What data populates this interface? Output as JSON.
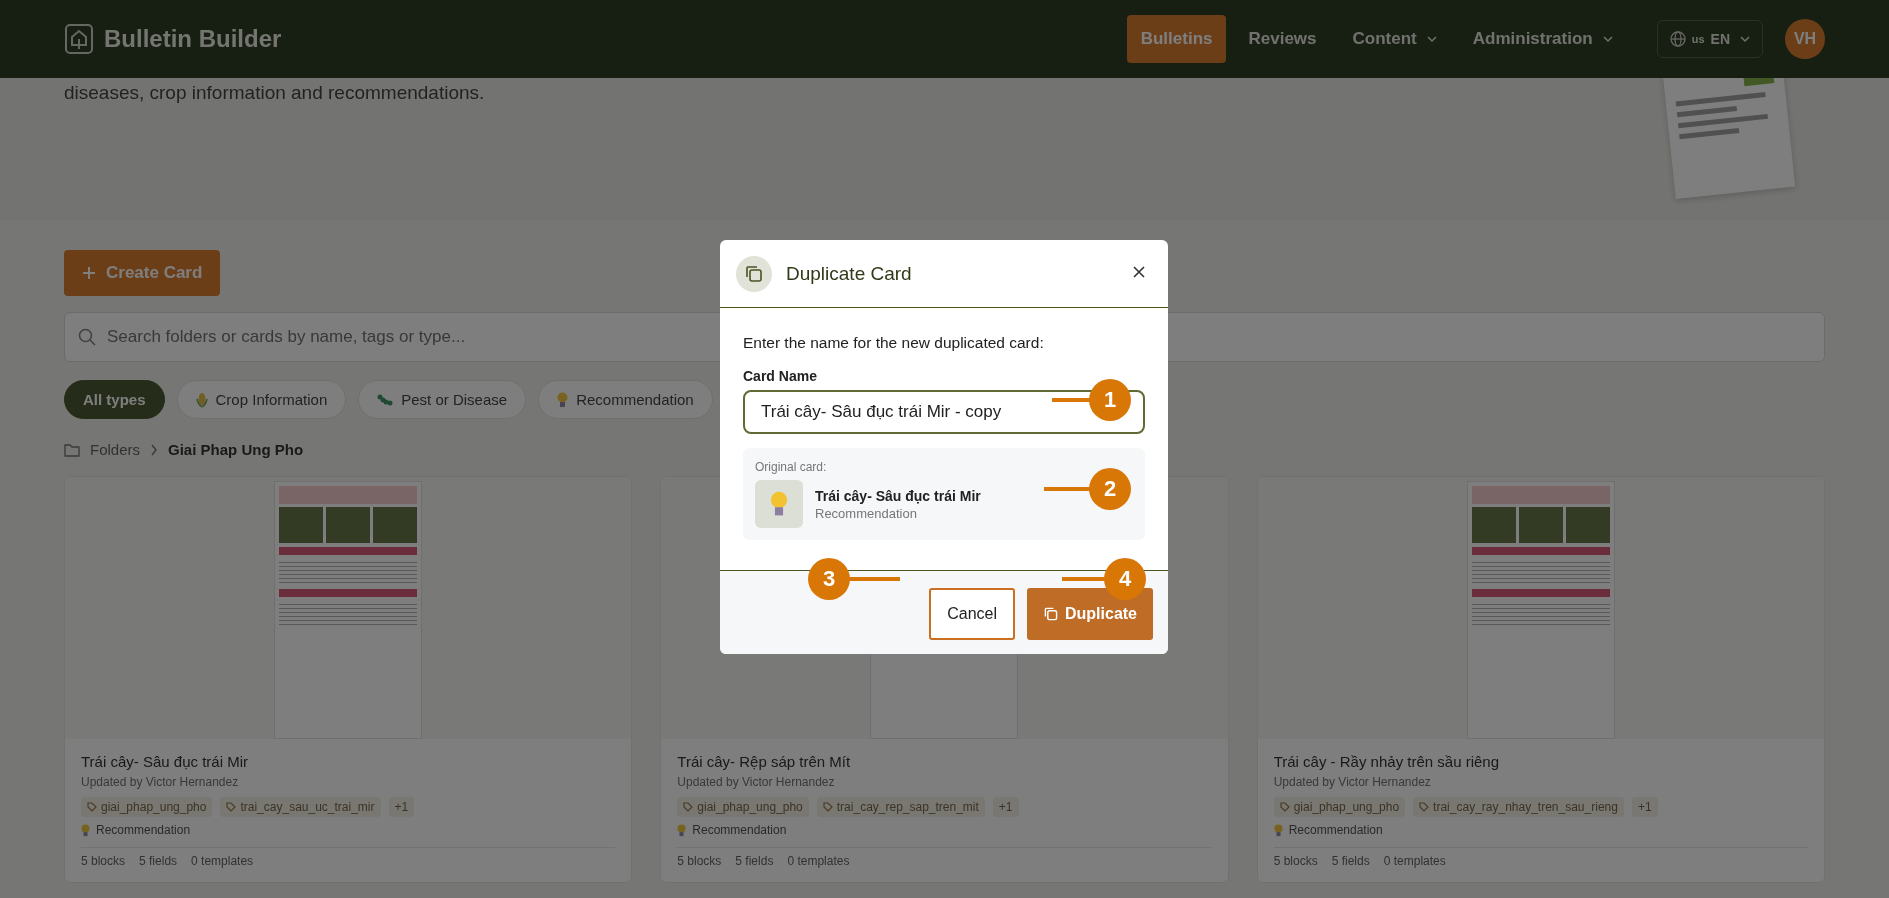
{
  "header": {
    "logo_text": "Bulletin Builder",
    "nav": [
      {
        "label": "Bulletins",
        "selected": true,
        "dropdown": false
      },
      {
        "label": "Reviews",
        "selected": false,
        "dropdown": false
      },
      {
        "label": "Content",
        "selected": false,
        "dropdown": true
      },
      {
        "label": "Administration",
        "selected": false,
        "dropdown": true
      }
    ],
    "language": {
      "flag": "us",
      "code": "EN"
    },
    "avatar": "VH"
  },
  "hero": {
    "description": "diseases, crop information and recommendations."
  },
  "create_button": "Create Card",
  "search": {
    "placeholder": "Search folders or cards by name, tags or type..."
  },
  "filters": [
    {
      "label": "All types",
      "kind": "all",
      "selected": true
    },
    {
      "label": "Crop Information",
      "kind": "crop",
      "selected": false
    },
    {
      "label": "Pest or Disease",
      "kind": "pest",
      "selected": false
    },
    {
      "label": "Recommendation",
      "kind": "recommendation",
      "selected": false
    }
  ],
  "breadcrumb": [
    "Folders",
    "Giai Phap Ung Pho"
  ],
  "cards": [
    {
      "title": "Trái cây- Sâu đục trái Mir",
      "updated": "Updated by Victor Hernandez",
      "tags": [
        "giai_phap_ung_pho",
        "trai_cay_sau_uc_trai_mir"
      ],
      "more": "+1",
      "type": "Recommendation",
      "stats": [
        "5 blocks",
        "5 fields",
        "0 templates"
      ]
    },
    {
      "title": "Trái cây- Rệp sáp trên Mít",
      "updated": "Updated by Victor Hernandez",
      "tags": [
        "giai_phap_ung_pho",
        "trai_cay_rep_sap_tren_mit"
      ],
      "more": "+1",
      "type": "Recommendation",
      "stats": [
        "5 blocks",
        "5 fields",
        "0 templates"
      ]
    },
    {
      "title": "Trái cây - Rầy nhảy trên sầu riêng",
      "updated": "Updated by Victor Hernandez",
      "tags": [
        "giai_phap_ung_pho",
        "trai_cay_ray_nhay_tren_sau_rieng"
      ],
      "more": "+1",
      "type": "Recommendation",
      "stats": [
        "5 blocks",
        "5 fields",
        "0 templates"
      ]
    }
  ],
  "modal": {
    "title": "Duplicate Card",
    "prompt": "Enter the name for the new duplicated card:",
    "field_label": "Card Name",
    "value": "Trái cây- Sâu đục trái Mir - copy",
    "original_label": "Original card:",
    "original_title": "Trái cây- Sâu đục trái Mir",
    "original_type": "Recommendation",
    "cancel": "Cancel",
    "confirm": "Duplicate"
  },
  "callouts": [
    "1",
    "2",
    "3",
    "4"
  ]
}
